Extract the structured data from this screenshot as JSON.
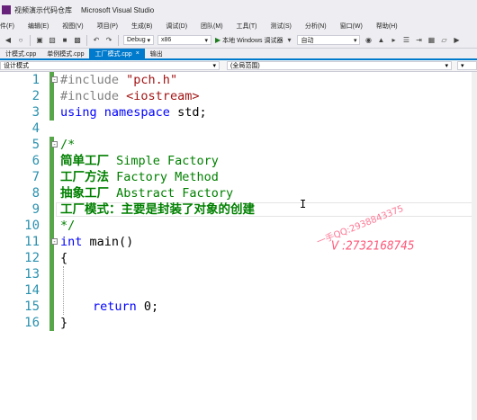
{
  "titlebar": {
    "project": "视频演示代码仓库",
    "app": "Microsoft Visual Studio"
  },
  "menubar": {
    "items": [
      "件(F)",
      "编辑(E)",
      "视图(V)",
      "项目(P)",
      "生成(B)",
      "调试(D)",
      "团队(M)",
      "工具(T)",
      "测试(S)",
      "分析(N)",
      "窗口(W)",
      "帮助(H)"
    ]
  },
  "toolbar": {
    "config": "Debug",
    "platform": "x86",
    "run_label": "本地 Windows 调试器",
    "auto": "自动"
  },
  "tabs": [
    {
      "label": "计模式.cpp",
      "active": false
    },
    {
      "label": "单例模式.cpp",
      "active": false
    },
    {
      "label": "工厂模式.cpp",
      "active": true
    },
    {
      "label": "输出",
      "active": false
    }
  ],
  "navbar": {
    "left": "设计模式",
    "middle": "(全局范围)"
  },
  "code": {
    "line_numbers": [
      "1",
      "2",
      "3",
      "4",
      "5",
      "6",
      "7",
      "8",
      "9",
      "10",
      "11",
      "12",
      "13",
      "14",
      "15",
      "16"
    ],
    "l1_directive": "#include",
    "l1_str": "\"pch.h\"",
    "l2_directive": "#include",
    "l2_str": "<iostream>",
    "l3_using": "using",
    "l3_namespace": "namespace",
    "l3_rest": " std;",
    "l6_comment": "/*",
    "l7_cjk": "简单工厂",
    "l7_en": " Simple Factory",
    "l8_cjk": "工厂方法",
    "l8_en": " Factory Method",
    "l9_cjk": "抽象工厂",
    "l9_en": " Abstract Factory",
    "l10_text": "工厂模式：主要是封装了对象的创建",
    "l11_comment": "*/",
    "l12_int": "int",
    "l12_rest": " main()",
    "l13_brace": "{",
    "l16_return": "return",
    "l16_rest": " 0;",
    "l17_brace": "}",
    "cursor": "I"
  },
  "watermark": {
    "qq": "一手QQ:2938843375",
    "wx": "V :2732168745"
  }
}
